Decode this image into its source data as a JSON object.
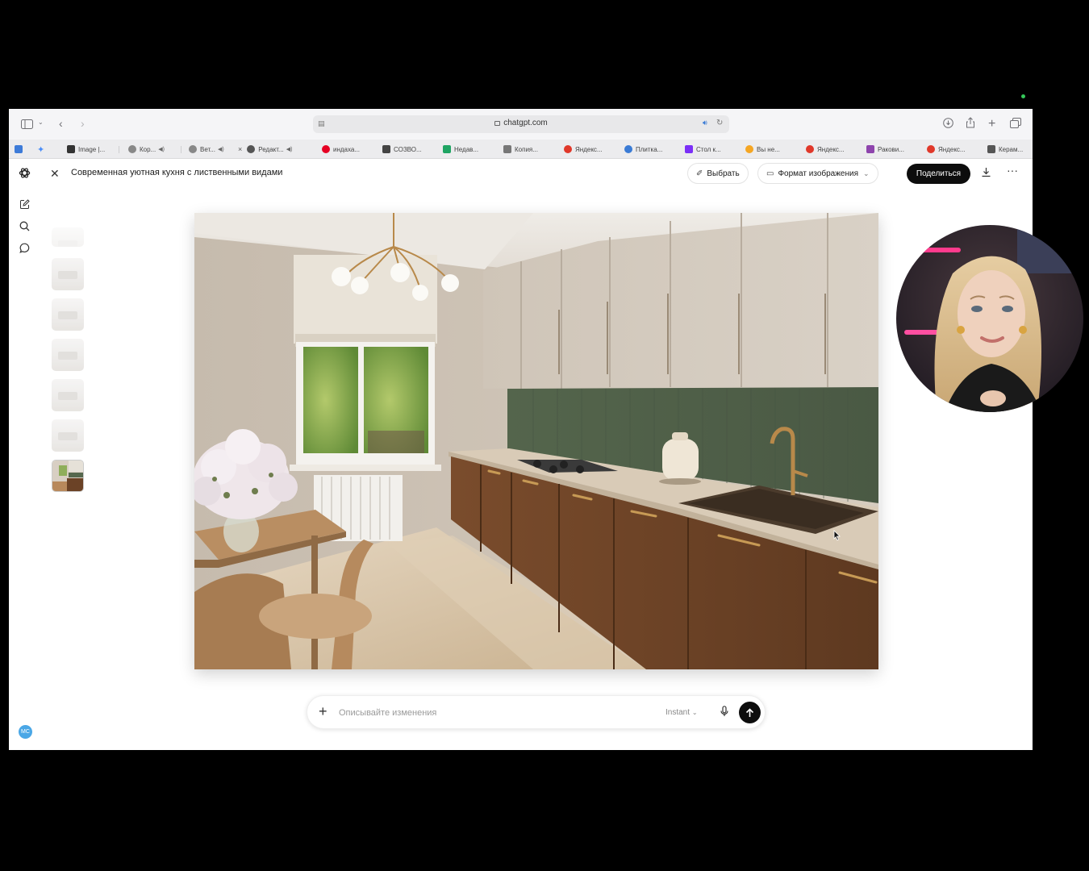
{
  "browser": {
    "url": "chatgpt.com",
    "tabs": [
      {
        "label": "Image |...",
        "color": "#333333"
      },
      {
        "label": "Кор...",
        "color": "#888888",
        "audio": true
      },
      {
        "label": "Вет...",
        "color": "#888888",
        "audio": true
      },
      {
        "label": "Редакт...",
        "color": "#555555",
        "audio": true
      },
      {
        "label": "индаха...",
        "color": "#e60023"
      },
      {
        "label": "СОЗВО...",
        "color": "#444444"
      },
      {
        "label": "Недав...",
        "color": "#1fa463"
      },
      {
        "label": "Копия...",
        "color": "#777777"
      },
      {
        "label": "Яндекс...",
        "color": "#e0382a"
      },
      {
        "label": "Плитка...",
        "color": "#3a7bd5"
      },
      {
        "label": "Стол к...",
        "color": "#7b2ff7"
      },
      {
        "label": "Вы не...",
        "color": "#f5a623"
      },
      {
        "label": "Яндекс...",
        "color": "#e0382a"
      },
      {
        "label": "Ракови...",
        "color": "#8e44ad"
      },
      {
        "label": "Яндекс...",
        "color": "#e0382a"
      },
      {
        "label": "Керам...",
        "color": "#555555"
      }
    ]
  },
  "app": {
    "title": "Современная уютная кухня с лиственными видами",
    "select_label": "Выбрать",
    "format_label": "Формат изображения",
    "share_label": "Поделиться",
    "avatar_initials": "МС",
    "composer": {
      "placeholder": "Описывайте изменения",
      "model": "Instant"
    }
  },
  "icons": [
    "sidebar-toggle-icon",
    "back-icon",
    "forward-icon",
    "speaker-icon",
    "reload-icon",
    "download-icon",
    "share-icon",
    "new-tab-icon",
    "tabs-overview-icon",
    "chatgpt-logo-icon",
    "new-chat-icon",
    "search-icon",
    "chat-bubble-icon",
    "close-icon",
    "select-icon",
    "image-format-icon",
    "more-icon",
    "plus-icon",
    "mic-icon",
    "send-icon"
  ]
}
